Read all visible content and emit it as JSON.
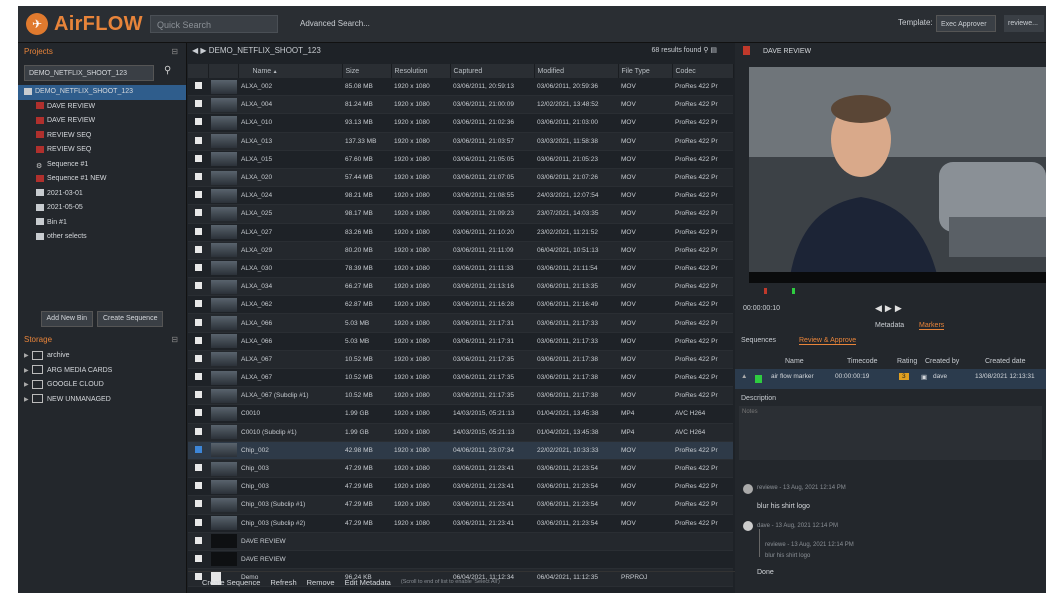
{
  "app": {
    "name": "AirFLOW",
    "logo_icon": "airflow-logo"
  },
  "header": {
    "quick_search_placeholder": "Quick Search",
    "advanced_search": "Advanced Search...",
    "template_label": "Template:",
    "template_value": "Exec Approver",
    "user": "reviewe..."
  },
  "left": {
    "projects_title": "Projects",
    "project_filter": "DEMO_NETFLIX_SHOOT_123",
    "tree": [
      {
        "label": "DEMO_NETFLIX_SHOOT_123",
        "type": "project",
        "selected": true
      },
      {
        "label": "DAVE REVIEW",
        "type": "red"
      },
      {
        "label": "DAVE REVIEW",
        "type": "red"
      },
      {
        "label": "REVIEW SEQ",
        "type": "red"
      },
      {
        "label": "REVIEW SEQ",
        "type": "red"
      },
      {
        "label": "Sequence #1",
        "type": "seq"
      },
      {
        "label": "Sequence #1 NEW",
        "type": "red"
      },
      {
        "label": "2021-03-01",
        "type": "dir"
      },
      {
        "label": "2021-05-05",
        "type": "dir"
      },
      {
        "label": "Bin #1",
        "type": "dir"
      },
      {
        "label": "other selects",
        "type": "dir"
      }
    ],
    "add_bin": "Add New Bin",
    "create_sequence": "Create Sequence",
    "storage_title": "Storage",
    "storage": [
      "archive",
      "ARG MEDIA CARDS",
      "GOOGLE CLOUD",
      "NEW UNMANAGED"
    ]
  },
  "center": {
    "breadcrumb": "DEMO_NETFLIX_SHOOT_123",
    "results": "68 results found",
    "columns": [
      "Name",
      "Size",
      "Resolution",
      "Captured",
      "Modified",
      "File Type",
      "Codec"
    ],
    "rows": [
      [
        "ALXA_002",
        "85.08 MB",
        "1920 x 1080",
        "03/06/2011, 20:59:13",
        "03/06/2011, 20:59:36",
        "MOV",
        "ProRes 422 Pr"
      ],
      [
        "ALXA_004",
        "81.24 MB",
        "1920 x 1080",
        "03/06/2011, 21:00:09",
        "12/02/2021, 13:48:52",
        "MOV",
        "ProRes 422 Pr"
      ],
      [
        "ALXA_010",
        "93.13 MB",
        "1920 x 1080",
        "03/06/2011, 21:02:36",
        "03/06/2011, 21:03:00",
        "MOV",
        "ProRes 422 Pr"
      ],
      [
        "ALXA_013",
        "137.33 MB",
        "1920 x 1080",
        "03/06/2011, 21:03:57",
        "03/03/2021, 11:58:38",
        "MOV",
        "ProRes 422 Pr"
      ],
      [
        "ALXA_015",
        "67.60 MB",
        "1920 x 1080",
        "03/06/2011, 21:05:05",
        "03/06/2011, 21:05:23",
        "MOV",
        "ProRes 422 Pr"
      ],
      [
        "ALXA_020",
        "57.44 MB",
        "1920 x 1080",
        "03/06/2011, 21:07:05",
        "03/06/2011, 21:07:26",
        "MOV",
        "ProRes 422 Pr"
      ],
      [
        "ALXA_024",
        "98.21 MB",
        "1920 x 1080",
        "03/06/2011, 21:08:55",
        "24/03/2021, 12:07:54",
        "MOV",
        "ProRes 422 Pr"
      ],
      [
        "ALXA_025",
        "98.17 MB",
        "1920 x 1080",
        "03/06/2011, 21:09:23",
        "23/07/2021, 14:03:35",
        "MOV",
        "ProRes 422 Pr"
      ],
      [
        "ALXA_027",
        "83.26 MB",
        "1920 x 1080",
        "03/06/2011, 21:10:20",
        "23/02/2021, 11:21:52",
        "MOV",
        "ProRes 422 Pr"
      ],
      [
        "ALXA_029",
        "80.20 MB",
        "1920 x 1080",
        "03/06/2011, 21:11:09",
        "06/04/2021, 10:51:13",
        "MOV",
        "ProRes 422 Pr"
      ],
      [
        "ALXA_030",
        "78.39 MB",
        "1920 x 1080",
        "03/06/2011, 21:11:33",
        "03/06/2011, 21:11:54",
        "MOV",
        "ProRes 422 Pr"
      ],
      [
        "ALXA_034",
        "66.27 MB",
        "1920 x 1080",
        "03/06/2011, 21:13:16",
        "03/06/2011, 21:13:35",
        "MOV",
        "ProRes 422 Pr"
      ],
      [
        "ALXA_062",
        "62.87 MB",
        "1920 x 1080",
        "03/06/2011, 21:16:28",
        "03/06/2011, 21:16:49",
        "MOV",
        "ProRes 422 Pr"
      ],
      [
        "ALXA_066",
        "5.03 MB",
        "1920 x 1080",
        "03/06/2011, 21:17:31",
        "03/06/2011, 21:17:33",
        "MOV",
        "ProRes 422 Pr"
      ],
      [
        "ALXA_066",
        "5.03 MB",
        "1920 x 1080",
        "03/06/2011, 21:17:31",
        "03/06/2011, 21:17:33",
        "MOV",
        "ProRes 422 Pr"
      ],
      [
        "ALXA_067",
        "10.52 MB",
        "1920 x 1080",
        "03/06/2011, 21:17:35",
        "03/06/2011, 21:17:38",
        "MOV",
        "ProRes 422 Pr"
      ],
      [
        "ALXA_067",
        "10.52 MB",
        "1920 x 1080",
        "03/06/2011, 21:17:35",
        "03/06/2011, 21:17:38",
        "MOV",
        "ProRes 422 Pr"
      ],
      [
        "ALXA_067 (Subclip #1)",
        "10.52 MB",
        "1920 x 1080",
        "03/06/2011, 21:17:35",
        "03/06/2011, 21:17:38",
        "MOV",
        "ProRes 422 Pr"
      ],
      [
        "C0010",
        "1.99 GB",
        "1920 x 1080",
        "14/03/2015, 05:21:13",
        "01/04/2021, 13:45:38",
        "MP4",
        "AVC H264"
      ],
      [
        "C0010 (Subclip #1)",
        "1.99 GB",
        "1920 x 1080",
        "14/03/2015, 05:21:13",
        "01/04/2021, 13:45:38",
        "MP4",
        "AVC H264"
      ],
      [
        "Chip_002",
        "42.98 MB",
        "1920 x 1080",
        "04/06/2011, 23:07:34",
        "22/02/2021, 10:33:33",
        "MOV",
        "ProRes 422 Pr"
      ],
      [
        "Chip_003",
        "47.29 MB",
        "1920 x 1080",
        "03/06/2011, 21:23:41",
        "03/06/2011, 21:23:54",
        "MOV",
        "ProRes 422 Pr"
      ],
      [
        "Chip_003",
        "47.29 MB",
        "1920 x 1080",
        "03/06/2011, 21:23:41",
        "03/06/2011, 21:23:54",
        "MOV",
        "ProRes 422 Pr"
      ],
      [
        "Chip_003 (Subclip #1)",
        "47.29 MB",
        "1920 x 1080",
        "03/06/2011, 21:23:41",
        "03/06/2011, 21:23:54",
        "MOV",
        "ProRes 422 Pr"
      ],
      [
        "Chip_003 (Subclip #2)",
        "47.29 MB",
        "1920 x 1080",
        "03/06/2011, 21:23:41",
        "03/06/2011, 21:23:54",
        "MOV",
        "ProRes 422 Pr"
      ],
      [
        "DAVE REVIEW",
        "",
        "",
        "",
        "",
        "",
        ""
      ],
      [
        "DAVE REVIEW",
        "",
        "",
        "",
        "",
        "",
        ""
      ],
      [
        "Demo",
        "96.24 KB",
        "",
        "06/04/2021, 11:12:34",
        "06/04/2021, 11:12:35",
        "PRPROJ",
        ""
      ]
    ],
    "selected_row": 20,
    "bottom": {
      "create_sequence": "Create Sequence",
      "refresh": "Refresh",
      "remove": "Remove",
      "edit_metadata": "Edit Metadata",
      "hint": "(Scroll to end of list to enable 'Select All')"
    }
  },
  "right": {
    "title": "DAVE REVIEW",
    "timecode": "00:00:00:10",
    "tab_metadata": "Metadata",
    "tab_markers": "Markers",
    "tab_sequences": "Sequences",
    "tab_review": "Review & Approve",
    "marker_cols": [
      "Name",
      "Timecode",
      "Rating",
      "Created by",
      "Created date"
    ],
    "marker": {
      "name": "air flow marker",
      "timecode": "00:00:00:19",
      "rating": "3",
      "created_by": "dave",
      "created_date": "13/08/2021 12:13:31"
    },
    "description_label": "Description",
    "notes_placeholder": "Notes",
    "comments": [
      {
        "meta": "reviewe - 13 Aug, 2021 12:14 PM",
        "text": "blur his shirt logo"
      },
      {
        "meta": "dave - 13 Aug, 2021 12:14 PM",
        "text": ""
      },
      {
        "meta": "reviewe - 13 Aug, 2021 12:14 PM",
        "text": "blur his shirt logo",
        "quote": true
      },
      {
        "meta": "",
        "text": "Done"
      }
    ]
  },
  "colors": {
    "accent": "#e8843a",
    "selected": "#2f5d8c",
    "panel": "#23272c"
  }
}
